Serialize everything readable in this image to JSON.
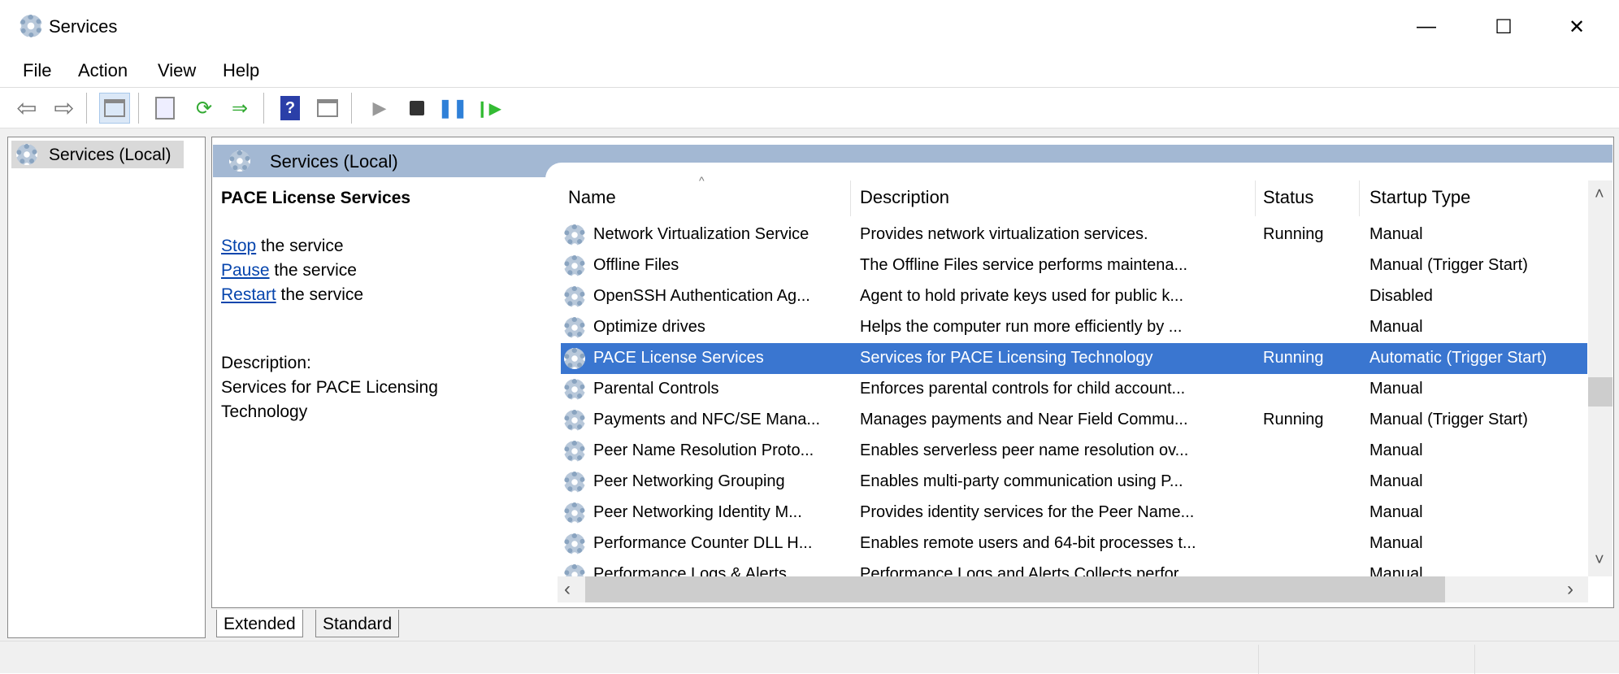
{
  "window": {
    "title": "Services",
    "minimize": "—",
    "maximize": "☐",
    "close": "✕"
  },
  "menu": [
    "File",
    "Action",
    "View",
    "Help"
  ],
  "toolbar": {
    "icons": [
      "back-icon",
      "forward-icon",
      "show-hide-console-tree-icon",
      "properties-icon",
      "refresh-icon",
      "export-list-icon",
      "help-icon",
      "show-hide-action-pane-icon",
      "start-service-icon",
      "stop-service-icon",
      "pause-service-icon",
      "resume-service-icon"
    ]
  },
  "tree": {
    "root": "Services (Local)"
  },
  "pane_header": "Services (Local)",
  "details": {
    "title": "PACE License Services",
    "actions": [
      {
        "link": "Stop",
        "rest": " the service"
      },
      {
        "link": "Pause",
        "rest": " the service"
      },
      {
        "link": "Restart",
        "rest": " the service"
      }
    ],
    "description_label": "Description:",
    "description": "Services for PACE Licensing Technology"
  },
  "columns": [
    "Name",
    "Description",
    "Status",
    "Startup Type"
  ],
  "rows": [
    {
      "name": "Network Virtualization Service",
      "desc": "Provides network virtualization services.",
      "status": "Running",
      "startup": "Manual"
    },
    {
      "name": "Offline Files",
      "desc": "The Offline Files service performs maintena...",
      "status": "",
      "startup": "Manual (Trigger Start)"
    },
    {
      "name": "OpenSSH Authentication Ag...",
      "desc": "Agent to hold private keys used for public k...",
      "status": "",
      "startup": "Disabled"
    },
    {
      "name": "Optimize drives",
      "desc": "Helps the computer run more efficiently by ...",
      "status": "",
      "startup": "Manual"
    },
    {
      "name": "PACE License Services",
      "desc": "Services for PACE Licensing Technology",
      "status": "Running",
      "startup": "Automatic (Trigger Start)",
      "selected": true
    },
    {
      "name": "Parental Controls",
      "desc": "Enforces parental controls for child account...",
      "status": "",
      "startup": "Manual"
    },
    {
      "name": "Payments and NFC/SE Mana...",
      "desc": "Manages payments and Near Field Commu...",
      "status": "Running",
      "startup": "Manual (Trigger Start)"
    },
    {
      "name": "Peer Name Resolution Proto...",
      "desc": "Enables serverless peer name resolution ov...",
      "status": "",
      "startup": "Manual"
    },
    {
      "name": "Peer Networking Grouping",
      "desc": "Enables multi-party communication using P...",
      "status": "",
      "startup": "Manual"
    },
    {
      "name": "Peer Networking Identity M...",
      "desc": "Provides identity services for the Peer Name...",
      "status": "",
      "startup": "Manual"
    },
    {
      "name": "Performance Counter DLL H...",
      "desc": "Enables remote users and 64-bit processes t...",
      "status": "",
      "startup": "Manual"
    },
    {
      "name": "Performance Logs & Alerts",
      "desc": "Performance Logs and Alerts Collects perfor...",
      "status": "",
      "startup": "Manual"
    }
  ],
  "tabs": [
    "Extended",
    "Standard"
  ],
  "scroll": {
    "up": "˄",
    "down": "˅",
    "left": "‹",
    "right": "›"
  }
}
